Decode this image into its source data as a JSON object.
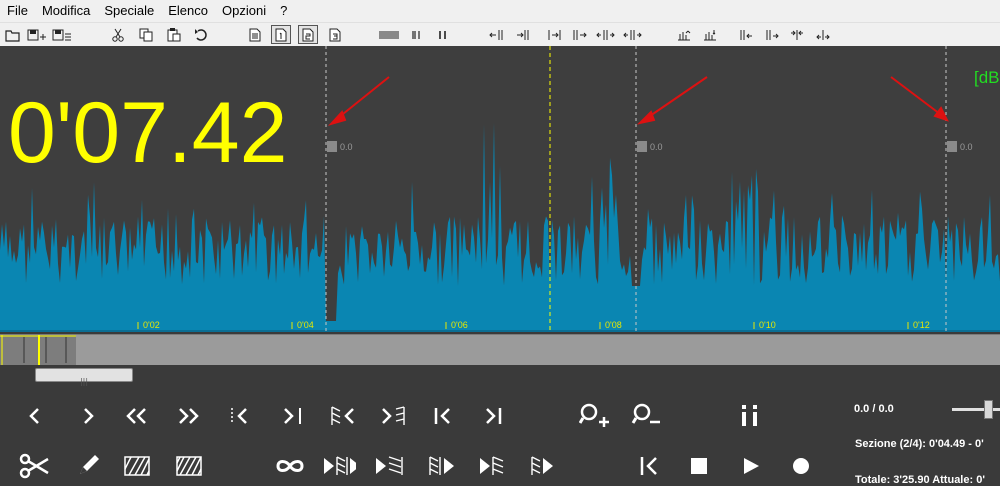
{
  "menu": [
    "File",
    "Modifica",
    "Speciale",
    "Elenco",
    "Opzioni",
    "?"
  ],
  "display": {
    "time": "0'07.42",
    "db_label": "[dB",
    "marker_levels": [
      "0.0",
      "0.0",
      "0.0"
    ]
  },
  "timeline": {
    "ticks": [
      "0'02",
      "0'04",
      "0'06",
      "0'08",
      "0'10",
      "0'12"
    ]
  },
  "info": {
    "level": "0.0 / 0.0",
    "section": "Sezione (2/4): 0'04.49 - 0'",
    "totals": "Totale: 3'25.90  Attuale: 0'"
  },
  "colors": {
    "wave": "#0a86b2",
    "time": "#ffff00",
    "db": "#22dd22",
    "marker_arrow": "#dd1111",
    "cursor": "#ffff00"
  },
  "controls_row1": [
    "prev-icon",
    "next-icon",
    "rewind-icon",
    "fast-forward-icon",
    "go-marker-left-icon",
    "go-marker-right-icon",
    "select-left-icon",
    "select-right-icon",
    "go-start-icon",
    "go-end-icon",
    "zoom-in-icon",
    "zoom-out-icon",
    "info-icon"
  ],
  "controls_row2": [
    "cut-icon",
    "edit-icon",
    "fade-in-icon",
    "fade-out-icon",
    "loop-icon",
    "play-selection-icon",
    "play-to-end-icon",
    "play-region-icon",
    "play-from-icon",
    "play-next-icon",
    "go-first-icon",
    "stop-icon",
    "play-icon",
    "record-icon"
  ]
}
